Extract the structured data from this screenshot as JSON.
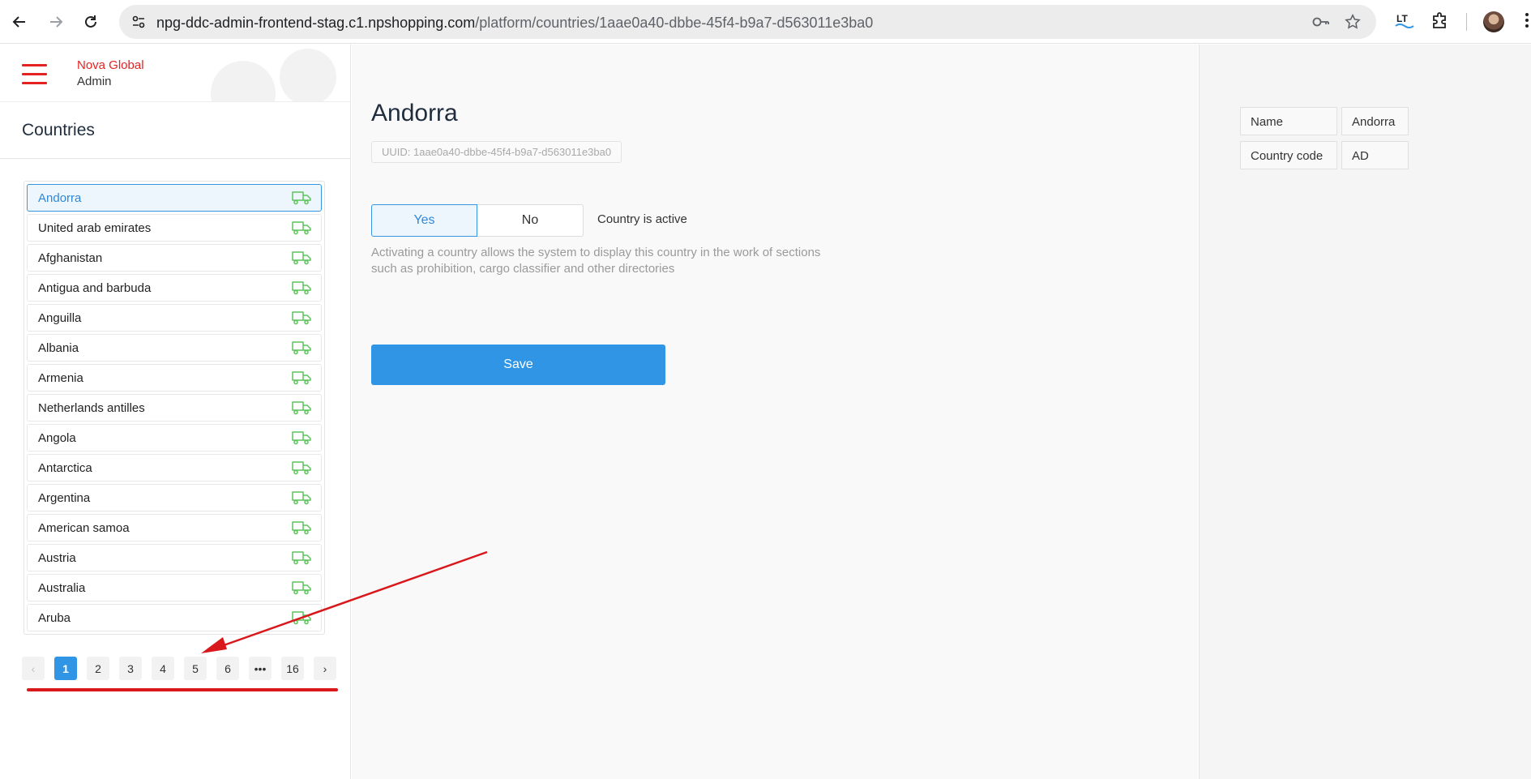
{
  "browser": {
    "url_host": "npg-ddc-admin-frontend-stag.c1.npshopping.com",
    "url_path": "/platform/countries/1aae0a40-dbbe-45f4-b9a7-d563011e3ba0",
    "icons": [
      "back-icon",
      "forward-icon",
      "reload-icon",
      "site-settings-icon",
      "password-key-icon",
      "bookmark-star-icon",
      "lt-extension-icon",
      "extensions-puzzle-icon",
      "profile-avatar",
      "more-menu-icon"
    ]
  },
  "sidebar": {
    "brand_line1": "Nova Global",
    "brand_line2": "Admin",
    "section_title": "Countries",
    "countries": [
      {
        "name": "Andorra",
        "active": true
      },
      {
        "name": "United arab emirates"
      },
      {
        "name": "Afghanistan"
      },
      {
        "name": "Antigua and barbuda"
      },
      {
        "name": "Anguilla"
      },
      {
        "name": "Albania"
      },
      {
        "name": "Armenia"
      },
      {
        "name": "Netherlands antilles"
      },
      {
        "name": "Angola"
      },
      {
        "name": "Antarctica"
      },
      {
        "name": "Argentina"
      },
      {
        "name": "American samoa"
      },
      {
        "name": "Austria"
      },
      {
        "name": "Australia"
      },
      {
        "name": "Aruba"
      }
    ],
    "pagination": {
      "prev": "‹",
      "pages": [
        "1",
        "2",
        "3",
        "4",
        "5",
        "6",
        "•••",
        "16"
      ],
      "next": "›",
      "current": "1"
    }
  },
  "main": {
    "title": "Andorra",
    "uuid": "UUID: 1aae0a40-dbbe-45f4-b9a7-d563011e3ba0",
    "toggle_yes": "Yes",
    "toggle_no": "No",
    "active_label": "Country is active",
    "help_line1": "Activating a country allows the system to display this country in the work of sections",
    "help_line2": "such as prohibition, cargo classifier and other directories",
    "save_label": "Save"
  },
  "details": {
    "name_label": "Name",
    "name_value": "Andorra",
    "code_label": "Country code",
    "code_value": "AD"
  },
  "colors": {
    "brand_red": "#e52222",
    "accent_blue": "#2f95e4",
    "truck_green": "#5cc35c",
    "annotation_red": "#d9181c"
  }
}
